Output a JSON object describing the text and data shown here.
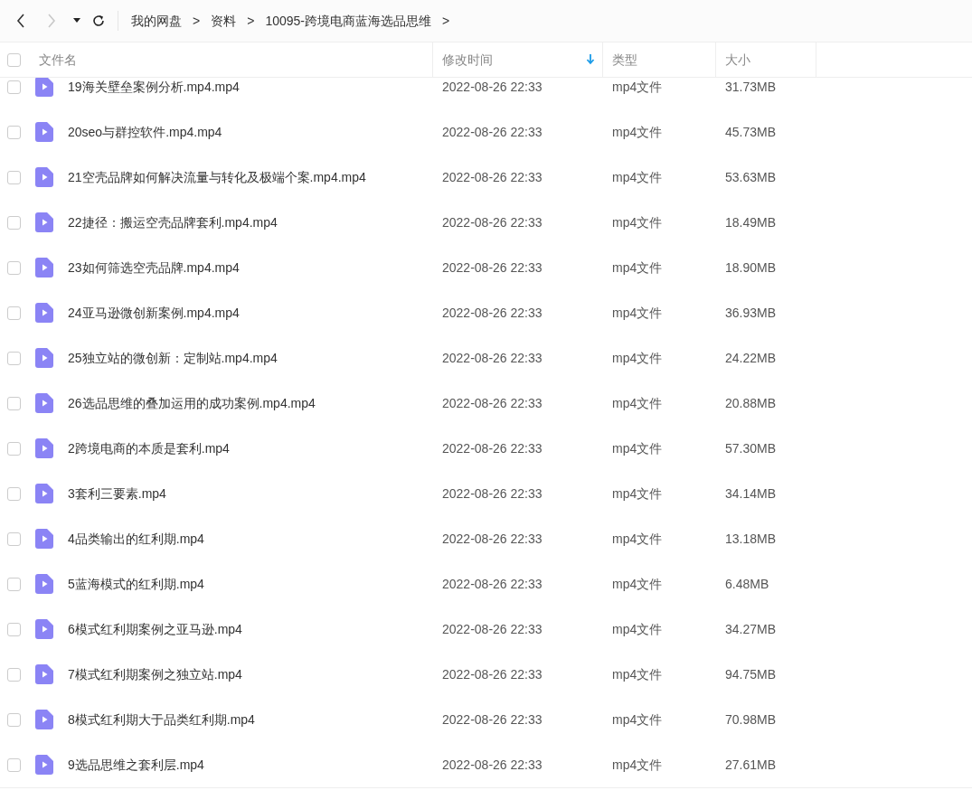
{
  "toolbar": {
    "back": {
      "disabled": false
    },
    "forward": {
      "disabled": true
    }
  },
  "breadcrumb": [
    {
      "label": "我的网盘"
    },
    {
      "label": "资料"
    },
    {
      "label": "10095-跨境电商蓝海选品思维"
    }
  ],
  "breadcrumb_separator": ">",
  "table": {
    "select_all": {
      "checked": false
    },
    "columns": [
      {
        "label": "文件名",
        "sorted": false
      },
      {
        "label": "修改时间",
        "sorted": true
      },
      {
        "label": "类型",
        "sorted": false
      },
      {
        "label": "大小",
        "sorted": false
      }
    ],
    "rows": [
      {
        "name": "19海关壁垒案例分析.mp4.mp4",
        "modified": "2022-08-26 22:33",
        "type": "mp4文件",
        "size": "31.73MB",
        "checked": false
      },
      {
        "name": "20seo与群控软件.mp4.mp4",
        "modified": "2022-08-26 22:33",
        "type": "mp4文件",
        "size": "45.73MB",
        "checked": false
      },
      {
        "name": "21空壳品牌如何解决流量与转化及极端个案.mp4.mp4",
        "modified": "2022-08-26 22:33",
        "type": "mp4文件",
        "size": "53.63MB",
        "checked": false
      },
      {
        "name": "22捷径：搬运空壳品牌套利.mp4.mp4",
        "modified": "2022-08-26 22:33",
        "type": "mp4文件",
        "size": "18.49MB",
        "checked": false
      },
      {
        "name": "23如何筛选空壳品牌.mp4.mp4",
        "modified": "2022-08-26 22:33",
        "type": "mp4文件",
        "size": "18.90MB",
        "checked": false
      },
      {
        "name": "24亚马逊微创新案例.mp4.mp4",
        "modified": "2022-08-26 22:33",
        "type": "mp4文件",
        "size": "36.93MB",
        "checked": false
      },
      {
        "name": "25独立站的微创新：定制站.mp4.mp4",
        "modified": "2022-08-26 22:33",
        "type": "mp4文件",
        "size": "24.22MB",
        "checked": false
      },
      {
        "name": "26选品思维的叠加运用的成功案例.mp4.mp4",
        "modified": "2022-08-26 22:33",
        "type": "mp4文件",
        "size": "20.88MB",
        "checked": false
      },
      {
        "name": "2跨境电商的本质是套利.mp4",
        "modified": "2022-08-26 22:33",
        "type": "mp4文件",
        "size": "57.30MB",
        "checked": false
      },
      {
        "name": "3套利三要素.mp4",
        "modified": "2022-08-26 22:33",
        "type": "mp4文件",
        "size": "34.14MB",
        "checked": false
      },
      {
        "name": "4品类输出的红利期.mp4",
        "modified": "2022-08-26 22:33",
        "type": "mp4文件",
        "size": "13.18MB",
        "checked": false
      },
      {
        "name": "5蓝海模式的红利期.mp4",
        "modified": "2022-08-26 22:33",
        "type": "mp4文件",
        "size": "6.48MB",
        "checked": false
      },
      {
        "name": "6模式红利期案例之亚马逊.mp4",
        "modified": "2022-08-26 22:33",
        "type": "mp4文件",
        "size": "34.27MB",
        "checked": false
      },
      {
        "name": "7模式红利期案例之独立站.mp4",
        "modified": "2022-08-26 22:33",
        "type": "mp4文件",
        "size": "94.75MB",
        "checked": false
      },
      {
        "name": "8模式红利期大于品类红利期.mp4",
        "modified": "2022-08-26 22:33",
        "type": "mp4文件",
        "size": "70.98MB",
        "checked": false
      },
      {
        "name": "9选品思维之套利层.mp4",
        "modified": "2022-08-26 22:33",
        "type": "mp4文件",
        "size": "27.61MB",
        "checked": false
      }
    ]
  }
}
